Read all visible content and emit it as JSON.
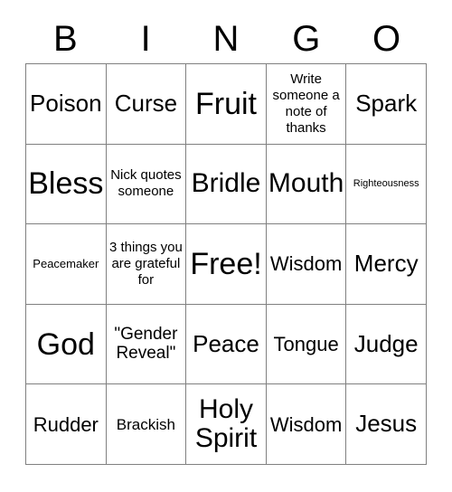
{
  "card": {
    "title": "Bingo Card",
    "header_letters": [
      "B",
      "I",
      "N",
      "G",
      "O"
    ],
    "colors": {
      "background": "#ffffff",
      "text": "#000000",
      "grid_line": "#808080"
    },
    "grid": {
      "columns": 5,
      "rows": 5,
      "free_space": "Free!",
      "cells": [
        {
          "text": "Poison",
          "size": "fs-l"
        },
        {
          "text": "Curse",
          "size": "fs-l"
        },
        {
          "text": "Fruit",
          "size": "fs-xxl"
        },
        {
          "text": "Write someone a note of thanks",
          "size": "fs-xxs"
        },
        {
          "text": "Spark",
          "size": "fs-l"
        },
        {
          "text": "Bless",
          "size": "fs-xxl"
        },
        {
          "text": "Nick quotes someone",
          "size": "fs-xxs"
        },
        {
          "text": "Bridle",
          "size": "fs-xl"
        },
        {
          "text": "Mouth",
          "size": "fs-xl"
        },
        {
          "text": "Righteousness",
          "size": "fs-tt"
        },
        {
          "text": "Peacemaker",
          "size": "fs-t"
        },
        {
          "text": "3 things you are grateful for",
          "size": "fs-xxs"
        },
        {
          "text": "Free!",
          "size": "fs-xxl"
        },
        {
          "text": "Wisdom",
          "size": "fs-m"
        },
        {
          "text": "Mercy",
          "size": "fs-l"
        },
        {
          "text": "God",
          "size": "fs-xxl"
        },
        {
          "text": "\"Gender Reveal\"",
          "size": "fs-s"
        },
        {
          "text": "Peace",
          "size": "fs-l"
        },
        {
          "text": "Tongue",
          "size": "fs-m"
        },
        {
          "text": "Judge",
          "size": "fs-l"
        },
        {
          "text": "Rudder",
          "size": "fs-m"
        },
        {
          "text": "Brackish",
          "size": "fs-xs"
        },
        {
          "text": "Holy Spirit",
          "size": "fs-xl"
        },
        {
          "text": "Wisdom",
          "size": "fs-m"
        },
        {
          "text": "Jesus",
          "size": "fs-l"
        }
      ]
    }
  }
}
